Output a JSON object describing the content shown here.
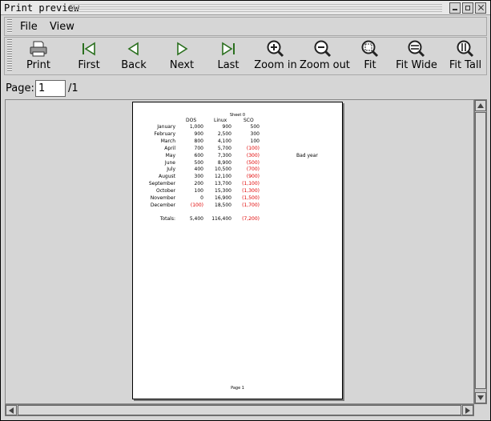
{
  "window": {
    "title": "Print preview"
  },
  "menu": [
    {
      "name": "menu-file",
      "label": "File"
    },
    {
      "name": "menu-view",
      "label": "View"
    }
  ],
  "toolbar": [
    {
      "name": "print-button",
      "icon": "printer-icon",
      "label": "Print"
    },
    {
      "name": "first-button",
      "icon": "first-page-icon",
      "label": "First"
    },
    {
      "name": "back-button",
      "icon": "back-arrow-icon",
      "label": "Back"
    },
    {
      "name": "next-button",
      "icon": "next-arrow-icon",
      "label": "Next"
    },
    {
      "name": "last-button",
      "icon": "last-page-icon",
      "label": "Last"
    },
    {
      "name": "zoom-in-button",
      "icon": "zoom-in-icon",
      "label": "Zoom in"
    },
    {
      "name": "zoom-out-button",
      "icon": "zoom-out-icon",
      "label": "Zoom out"
    },
    {
      "name": "fit-button",
      "icon": "fit-icon",
      "label": "Fit"
    },
    {
      "name": "fit-wide-button",
      "icon": "fit-wide-icon",
      "label": "Fit Wide"
    },
    {
      "name": "fit-tall-button",
      "icon": "fit-tall-icon",
      "label": "Fit Tall"
    }
  ],
  "page_nav": {
    "label": "Page:",
    "current": "1",
    "total": "/1"
  },
  "preview": {
    "sheet_name": "Sheet 0",
    "columns": [
      "DOS",
      "Linux",
      "SCO"
    ],
    "rows": [
      {
        "label": "January",
        "dos": "1,000",
        "linux": "900",
        "sco": "500",
        "sco_negative": false,
        "dos_negative": false,
        "note": ""
      },
      {
        "label": "February",
        "dos": "900",
        "linux": "2,500",
        "sco": "300",
        "sco_negative": false,
        "dos_negative": false,
        "note": ""
      },
      {
        "label": "March",
        "dos": "800",
        "linux": "4,100",
        "sco": "100",
        "sco_negative": false,
        "dos_negative": false,
        "note": ""
      },
      {
        "label": "April",
        "dos": "700",
        "linux": "5,700",
        "sco": "(100)",
        "sco_negative": true,
        "dos_negative": false,
        "note": ""
      },
      {
        "label": "May",
        "dos": "600",
        "linux": "7,300",
        "sco": "(300)",
        "sco_negative": true,
        "dos_negative": false,
        "note": "Bad year"
      },
      {
        "label": "June",
        "dos": "500",
        "linux": "8,900",
        "sco": "(500)",
        "sco_negative": true,
        "dos_negative": false,
        "note": ""
      },
      {
        "label": "July",
        "dos": "400",
        "linux": "10,500",
        "sco": "(700)",
        "sco_negative": true,
        "dos_negative": false,
        "note": ""
      },
      {
        "label": "August",
        "dos": "300",
        "linux": "12,100",
        "sco": "(900)",
        "sco_negative": true,
        "dos_negative": false,
        "note": ""
      },
      {
        "label": "September",
        "dos": "200",
        "linux": "13,700",
        "sco": "(1,100)",
        "sco_negative": true,
        "dos_negative": false,
        "note": ""
      },
      {
        "label": "October",
        "dos": "100",
        "linux": "15,300",
        "sco": "(1,300)",
        "sco_negative": true,
        "dos_negative": false,
        "note": ""
      },
      {
        "label": "November",
        "dos": "0",
        "linux": "16,900",
        "sco": "(1,500)",
        "sco_negative": true,
        "dos_negative": false,
        "note": ""
      },
      {
        "label": "December",
        "dos": "(100)",
        "linux": "18,500",
        "sco": "(1,700)",
        "sco_negative": true,
        "dos_negative": true,
        "note": ""
      }
    ],
    "totals": {
      "label": "Totals:",
      "dos": "5,400",
      "linux": "116,400",
      "sco": "(7,200)",
      "sco_negative": true
    },
    "footer": "Page 1"
  },
  "colors": {
    "negative": "#e00000",
    "background": "#d6d6d6",
    "paper": "#ffffff"
  }
}
